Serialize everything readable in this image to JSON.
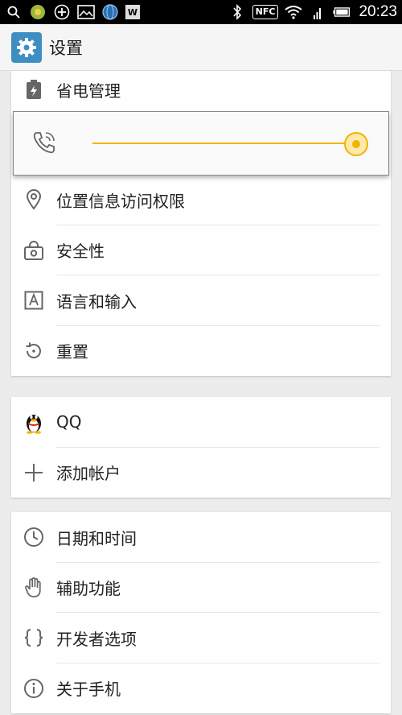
{
  "status_bar": {
    "time": "20:23",
    "nfc": "NFC",
    "w_icon": "W",
    "icons": [
      "search-icon",
      "app-icon",
      "plus-circle-icon",
      "image-icon",
      "globe-icon",
      "w-icon",
      "bluetooth-icon",
      "nfc-icon",
      "wifi-icon",
      "signal-icon",
      "battery-icon"
    ]
  },
  "header": {
    "title": "设置",
    "icon": "gear-icon"
  },
  "volume": {
    "icon": "phone-ringer-icon",
    "level": 1.0
  },
  "sections": {
    "personal": [
      {
        "label": "省电管理",
        "icon": "battery-saver-icon"
      },
      {
        "label": "位置信息访问权限",
        "icon": "location-icon"
      },
      {
        "label": "安全性",
        "icon": "lock-icon"
      },
      {
        "label": "语言和输入",
        "icon": "keyboard-a-icon"
      },
      {
        "label": "重置",
        "icon": "reset-icon"
      }
    ],
    "accounts": [
      {
        "label": "QQ",
        "icon": "qq-penguin-icon"
      },
      {
        "label": "添加帐户",
        "icon": "plus-icon"
      }
    ],
    "system": [
      {
        "label": "日期和时间",
        "icon": "clock-icon"
      },
      {
        "label": "辅助功能",
        "icon": "hand-icon"
      },
      {
        "label": "开发者选项",
        "icon": "braces-icon"
      },
      {
        "label": "关于手机",
        "icon": "info-icon"
      }
    ]
  },
  "colors": {
    "accent": "#f0b400",
    "header_icon": "#3f8ec2"
  }
}
